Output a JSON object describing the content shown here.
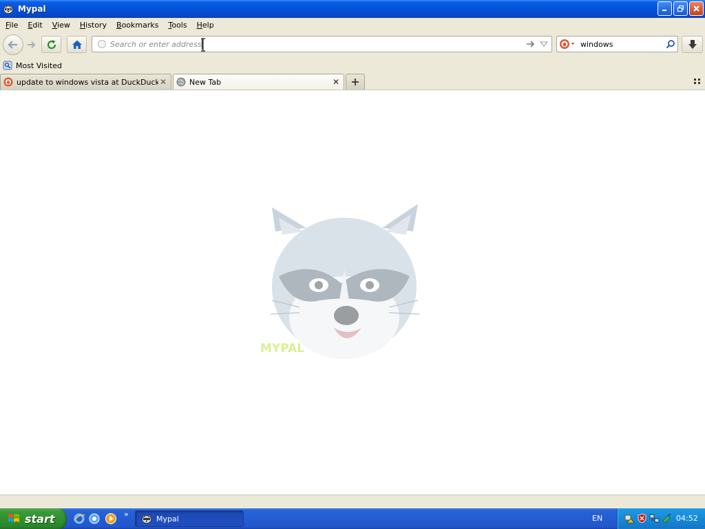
{
  "window": {
    "title": "Mypal"
  },
  "menu": {
    "items": [
      "File",
      "Edit",
      "View",
      "History",
      "Bookmarks",
      "Tools",
      "Help"
    ]
  },
  "toolbar": {
    "url_placeholder": "Search or enter address",
    "search_value": "windows"
  },
  "bookmarks": {
    "most_visited": "Most Visited"
  },
  "tabs": [
    {
      "label": "update to windows vista at DuckDuckGo",
      "active": false
    },
    {
      "label": "New Tab",
      "active": true
    }
  ],
  "taskbar": {
    "start_label": "start",
    "task_label": "Mypal",
    "language": "EN",
    "clock": "04:52"
  },
  "colors": {
    "titlebar": "#0552d8",
    "chrome": "#ece9d8",
    "start_green": "#2f8f2f",
    "tray_blue": "#158ad8"
  },
  "icons": {
    "back": "back-arrow-icon",
    "forward": "forward-arrow-icon",
    "reload": "reload-icon",
    "home": "home-icon",
    "go": "go-arrow-icon",
    "search": "magnifier-icon",
    "download": "download-arrow-icon",
    "mascot": "raccoon-logo"
  }
}
